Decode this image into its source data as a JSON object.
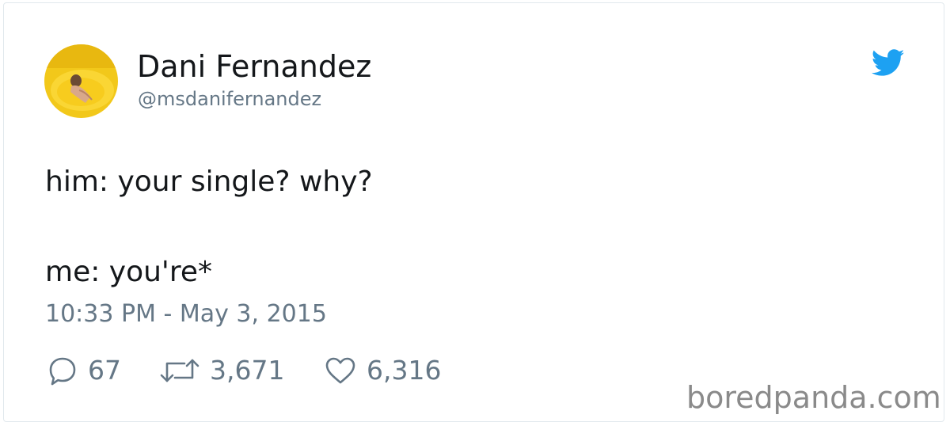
{
  "tweet": {
    "author": {
      "name": "Dani Fernandez",
      "handle": "@msdanifernandez"
    },
    "text_lines": [
      "him: your single? why?",
      "me: you're*"
    ],
    "timestamp": "10:33 PM - May 3, 2015",
    "stats": {
      "replies": "67",
      "retweets": "3,671",
      "likes": "6,316"
    }
  },
  "watermark": "boredpanda.com",
  "colors": {
    "twitter_blue": "#1da1f2",
    "secondary_text": "#657786",
    "primary_text": "#14171a"
  },
  "icons": {
    "brand": "twitter-bird-icon",
    "reply": "reply-icon",
    "retweet": "retweet-icon",
    "like": "heart-icon"
  }
}
